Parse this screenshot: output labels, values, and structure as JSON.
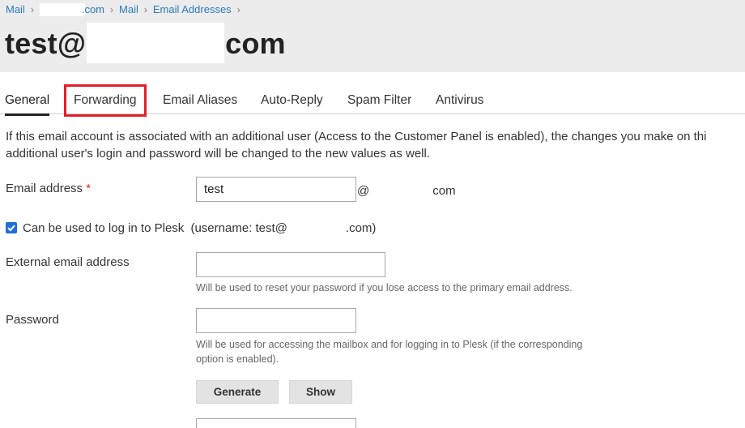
{
  "breadcrumb": {
    "item1_suffix": ".com",
    "item2": "Mail",
    "item3": "Email Addresses",
    "home": "Mail"
  },
  "page_title": {
    "prefix": "test@",
    "suffix": "com"
  },
  "tabs": [
    {
      "label": "General",
      "active": true
    },
    {
      "label": "Forwarding",
      "highlighted": true
    },
    {
      "label": "Email Aliases"
    },
    {
      "label": "Auto-Reply"
    },
    {
      "label": "Spam Filter"
    },
    {
      "label": "Antivirus"
    }
  ],
  "intro": {
    "line1": "If this email account is associated with an additional user (Access to the Customer Panel is enabled), the changes you make on thi",
    "line2": "additional user's login and password will be changed to the new values as well."
  },
  "form": {
    "email_address": {
      "label": "Email address",
      "required_mark": "*",
      "value": "test",
      "at": "@",
      "domain_suffix": "com"
    },
    "login_checkbox": {
      "checked": true,
      "label": "Can be used to log in to Plesk",
      "username_prefix": "(username: test@",
      "username_suffix": ".com)"
    },
    "external_email": {
      "label": "External email address",
      "value": "",
      "hint": "Will be used to reset your password if you lose access to the primary email address."
    },
    "password": {
      "label": "Password",
      "value": "",
      "hint_line1": "Will be used for accessing the mailbox and for logging in to Plesk (if the corresponding",
      "hint_line2": "option is enabled).",
      "generate_label": "Generate",
      "show_label": "Show"
    }
  },
  "colors": {
    "link": "#2b7abc",
    "header_bg": "#ececec",
    "highlight": "#e0202a",
    "checkbox": "#1e6fd9"
  }
}
